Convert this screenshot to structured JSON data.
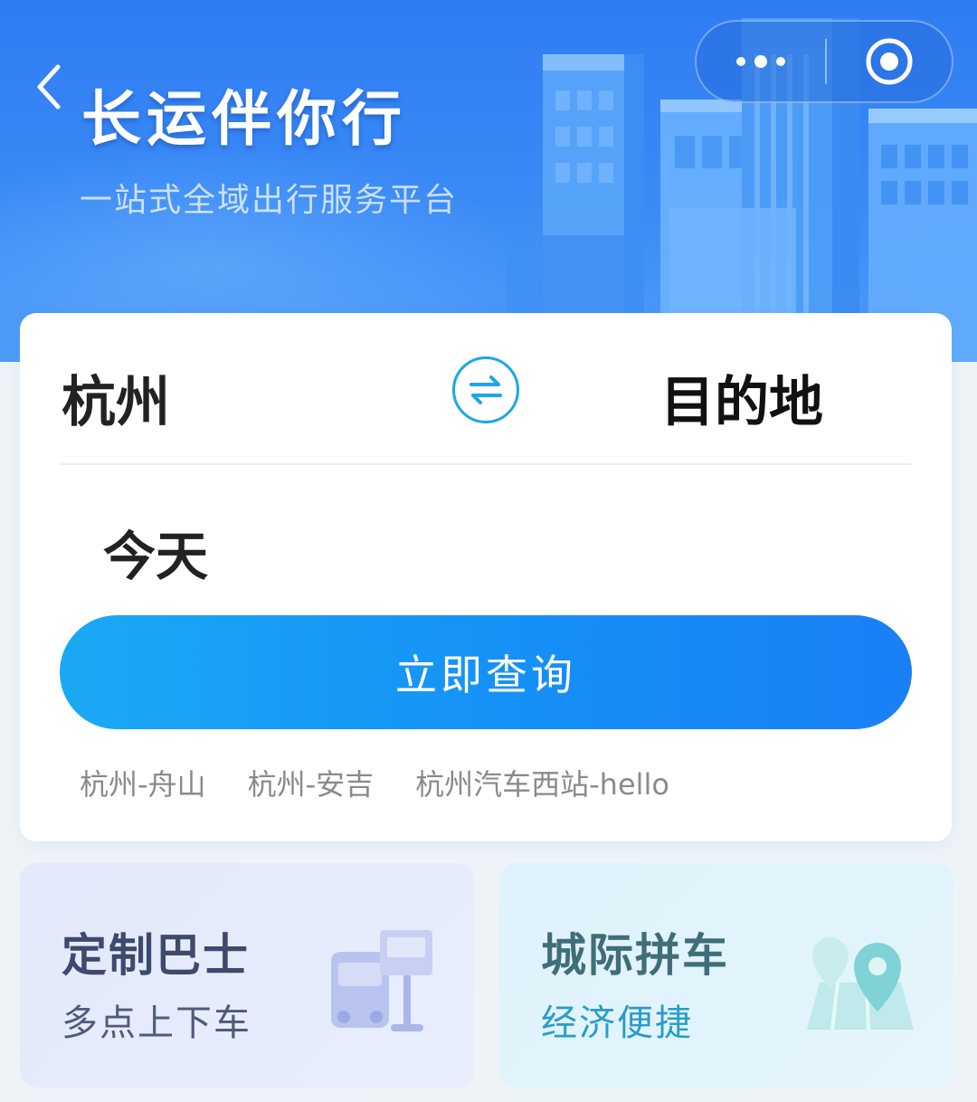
{
  "header": {
    "title": "长运伴你行",
    "subtitle": "一站式全域出行服务平台",
    "back_icon": "chevron-left-icon",
    "more_icon": "more-dots-icon",
    "close_icon": "target-close-icon"
  },
  "search": {
    "from_city": "杭州",
    "to_city": "目的地",
    "swap_icon": "swap-arrows-icon",
    "date": "今天",
    "submit_label": "立即查询",
    "history": [
      "杭州-舟山",
      "杭州-安吉",
      "杭州汽车西站-hello"
    ]
  },
  "services": [
    {
      "title": "定制巴士",
      "subtitle": "多点上下车",
      "icon": "bus-stop-icon"
    },
    {
      "title": "城际拼车",
      "subtitle": "经济便捷",
      "icon": "map-pin-icon"
    }
  ],
  "colors": {
    "banner": "#2f7cf3",
    "accent": "#1590f7",
    "swap_ring": "#1ea6e6",
    "carpool_sub": "#2a9cc9"
  }
}
